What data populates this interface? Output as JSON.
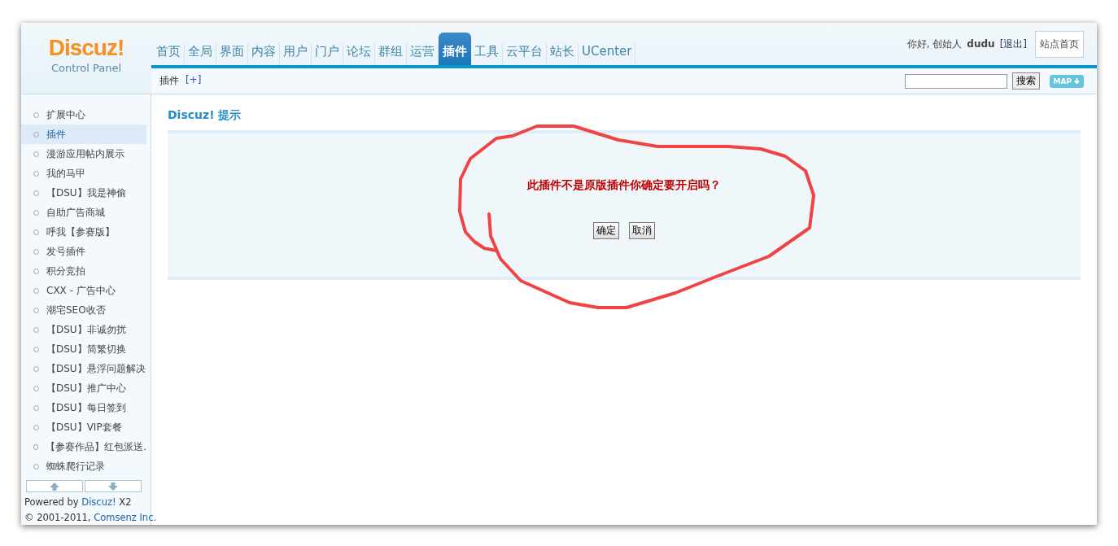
{
  "logo": {
    "title": "Discuz!",
    "subtitle": "Control Panel"
  },
  "nav_tabs": [
    {
      "label": "首页",
      "selected": false
    },
    {
      "label": "全局",
      "selected": false
    },
    {
      "label": "界面",
      "selected": false
    },
    {
      "label": "内容",
      "selected": false
    },
    {
      "label": "用户",
      "selected": false
    },
    {
      "label": "门户",
      "selected": false
    },
    {
      "label": "论坛",
      "selected": false
    },
    {
      "label": "群组",
      "selected": false
    },
    {
      "label": "运营",
      "selected": false
    },
    {
      "label": "插件",
      "selected": true
    },
    {
      "label": "工具",
      "selected": false
    },
    {
      "label": "云平台",
      "selected": false
    },
    {
      "label": "站长",
      "selected": false
    },
    {
      "label": "UCenter",
      "selected": false
    }
  ],
  "user_bar": {
    "greeting": "你好, 创始人",
    "username": "dudu",
    "logout": "[退出]",
    "home_button": "站点首页"
  },
  "breadcrumb": {
    "label": "插件",
    "add": "[+]"
  },
  "search": {
    "button": "搜索",
    "map_button": "MAP"
  },
  "sidebar": {
    "items": [
      {
        "label": "扩展中心",
        "selected": false
      },
      {
        "label": "插件",
        "selected": true
      },
      {
        "label": "漫游应用帖内展示",
        "selected": false
      },
      {
        "label": "我的马甲",
        "selected": false
      },
      {
        "label": "【DSU】我是神偷",
        "selected": false
      },
      {
        "label": "自助广告商城",
        "selected": false
      },
      {
        "label": "呼我【参赛版】",
        "selected": false
      },
      {
        "label": "发号插件",
        "selected": false
      },
      {
        "label": "积分竞拍",
        "selected": false
      },
      {
        "label": "CXX - 广告中心",
        "selected": false
      },
      {
        "label": "潮宅SEO收否",
        "selected": false
      },
      {
        "label": "【DSU】非诚勿扰",
        "selected": false
      },
      {
        "label": "【DSU】简繁切换",
        "selected": false
      },
      {
        "label": "【DSU】悬浮问题解决",
        "selected": false
      },
      {
        "label": "【DSU】推广中心",
        "selected": false
      },
      {
        "label": "【DSU】每日签到",
        "selected": false
      },
      {
        "label": "【DSU】VIP套餐",
        "selected": false
      },
      {
        "label": "【参赛作品】红包派送.",
        "selected": false
      },
      {
        "label": "蜘蛛爬行记录",
        "selected": false
      }
    ],
    "powered_by": "Powered by",
    "powered_link": "Discuz!",
    "version": "X2",
    "copyright": "© 2001-2011,",
    "company_link": "Comsenz Inc."
  },
  "message": {
    "title": "Discuz! 提示",
    "text": "此插件不是原版插件你确定要开启吗？",
    "buttons": [
      "确定",
      "取消"
    ]
  }
}
